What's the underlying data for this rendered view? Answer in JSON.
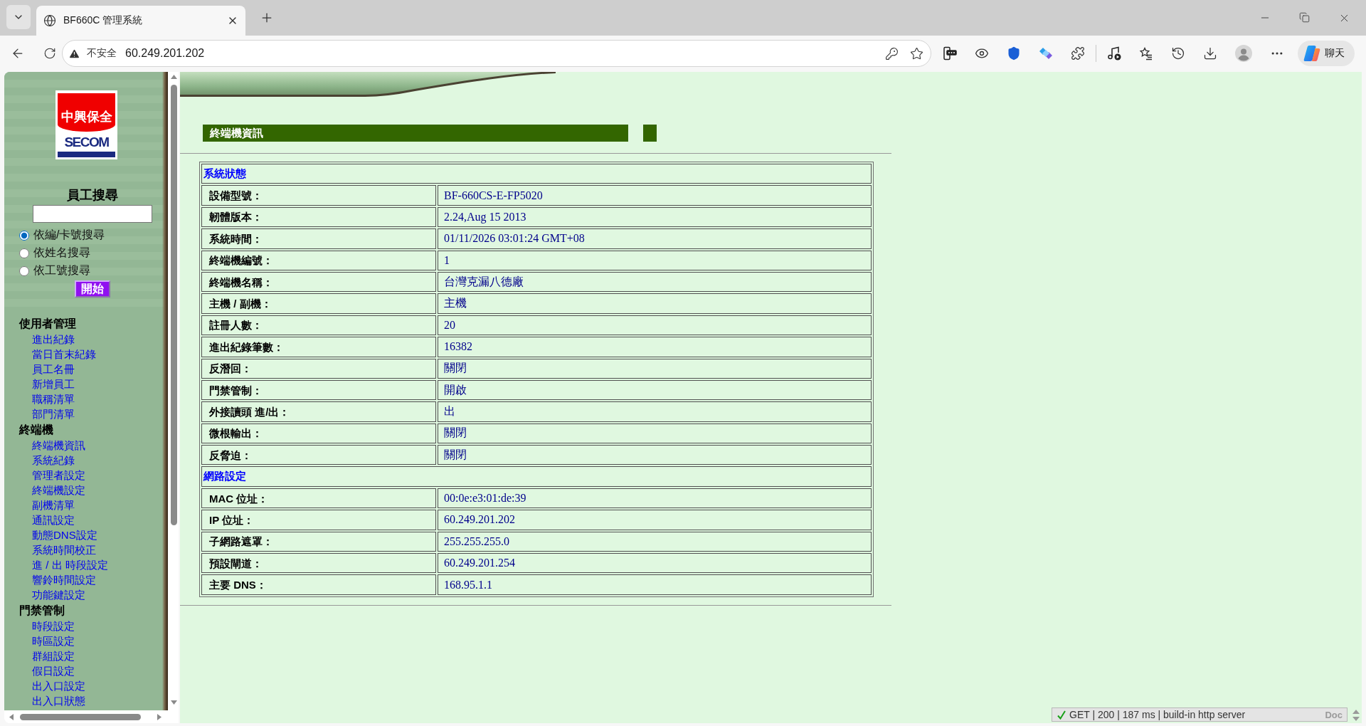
{
  "browser": {
    "tab_title": "BF660C 管理系統",
    "security_label": "不安全",
    "url": "60.249.201.202",
    "chat_label": "聊天"
  },
  "sidebar": {
    "logo": {
      "top_text": "中興保全",
      "bottom_text": "SECOM"
    },
    "search": {
      "title": "員工搜尋",
      "options": [
        {
          "label": "依編/卡號搜尋",
          "selected": true
        },
        {
          "label": "依姓名搜尋",
          "selected": false
        },
        {
          "label": "依工號搜尋",
          "selected": false
        }
      ],
      "button": "開始"
    },
    "menu": [
      {
        "label": "使用者管理",
        "children": [
          {
            "label": "進出紀錄"
          },
          {
            "label": "當日首末紀錄"
          },
          {
            "label": "員工名冊"
          },
          {
            "label": "新增員工"
          },
          {
            "label": "職稱清單"
          },
          {
            "label": "部門清單"
          }
        ]
      },
      {
        "label": "終端機",
        "children": [
          {
            "label": "終端機資訊"
          },
          {
            "label": "系統紀錄"
          },
          {
            "label": "管理者設定"
          },
          {
            "label": "終端機設定"
          },
          {
            "label": "副機清單"
          },
          {
            "label": "通訊設定"
          },
          {
            "label": "動態DNS設定"
          },
          {
            "label": "系統時間校正"
          },
          {
            "label": "進 / 出 時段設定"
          },
          {
            "label": "響鈴時間設定"
          },
          {
            "label": "功能鍵設定"
          }
        ]
      },
      {
        "label": "門禁管制",
        "children": [
          {
            "label": "時段設定"
          },
          {
            "label": "時區設定"
          },
          {
            "label": "群組設定"
          },
          {
            "label": "假日設定"
          },
          {
            "label": "出入口設定"
          },
          {
            "label": "出入口狀態"
          }
        ]
      }
    ]
  },
  "content": {
    "title": "終端機資訊",
    "sections": [
      {
        "title": "系統狀態",
        "rows": [
          {
            "label": "設備型號：",
            "value": "BF-660CS-E-FP5020"
          },
          {
            "label": "韌體版本：",
            "value": "2.24,Aug 15 2013"
          },
          {
            "label": "系統時間：",
            "value": "01/11/2026 03:01:24 GMT+08"
          },
          {
            "label": "終端機編號：",
            "value": "1"
          },
          {
            "label": "終端機名稱：",
            "value": "台灣克漏八德廠"
          },
          {
            "label": "主機 / 副機：",
            "value": "主機"
          },
          {
            "label": "註冊人數：",
            "value": "20"
          },
          {
            "label": "進出紀錄筆數：",
            "value": "16382"
          },
          {
            "label": "反潛回：",
            "value": "關閉"
          },
          {
            "label": "門禁管制：",
            "value": "開啟"
          },
          {
            "label": "外接讀頭 進/出：",
            "value": "出"
          },
          {
            "label": "微根輸出：",
            "value": "關閉"
          },
          {
            "label": "反脅迫：",
            "value": "關閉"
          }
        ]
      },
      {
        "title": "網路設定",
        "rows": [
          {
            "label": "MAC 位址：",
            "value": "00:0e:e3:01:de:39"
          },
          {
            "label": "IP 位址：",
            "value": "60.249.201.202"
          },
          {
            "label": "子網路遮罩：",
            "value": "255.255.255.0"
          },
          {
            "label": "預設閘道：",
            "value": "60.249.201.254"
          },
          {
            "label": "主要 DNS：",
            "value": "168.95.1.1"
          }
        ]
      }
    ]
  },
  "status_overlay": {
    "text": "GET | 200 | 187 ms | build-in http server",
    "doc_label": "Doc"
  }
}
